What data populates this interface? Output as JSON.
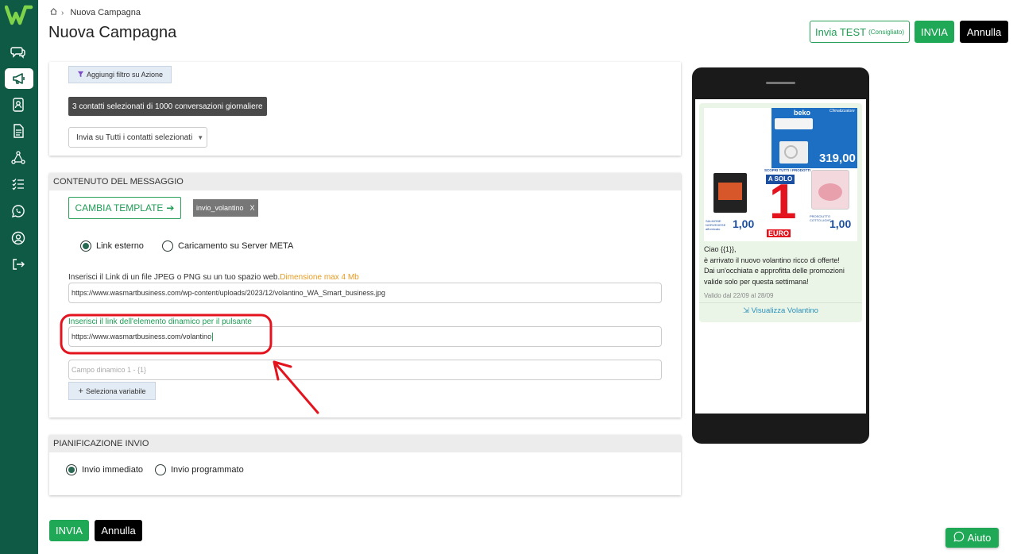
{
  "breadcrumb": {
    "current": "Nuova Campagna"
  },
  "header": {
    "title": "Nuova Campagna",
    "test_label": "Invia TEST",
    "test_hint": "(Consigliato)",
    "send_label": "INVIA",
    "cancel_label": "Annulla"
  },
  "filters": {
    "add_filter_label": "Aggiungi filtro su Azione",
    "selected_contacts": "3 contatti selezionati di 1000 conversazioni giornaliere",
    "send_scope": "Invia su Tutti i contatti selezionati"
  },
  "content": {
    "section_title": "CONTENUTO DEL MESSAGGIO",
    "change_template_label": "CAMBIA TEMPLATE",
    "template_chip": "invio_volantino",
    "template_chip_close": "X",
    "radio_external": "Link esterno",
    "radio_meta": "Caricamento su Server META",
    "link_label": "Inserisci il Link di un file JPEG o PNG su un tuo spazio web.",
    "link_size_hint": "Dimensione max 4 Mb",
    "link_value": "https://www.wasmartbusiness.com/wp-content/uploads/2023/12/volantino_WA_Smart_business.jpg",
    "dynamic_label": "Inserisci il link dell'elemento dinamico per il pulsante",
    "dynamic_value": "https://www.wasmartbusiness.com/volantino",
    "dynamic_field_placeholder": "Campo dinamico 1 - {1}",
    "select_variable_label": "Seleziona variabile"
  },
  "schedule": {
    "section_title": "PIANIFICAZIONE INVIO",
    "radio_immediate": "Invio immediato",
    "radio_scheduled": "Invio programmato"
  },
  "footer": {
    "send_label": "INVIA",
    "cancel_label": "Annulla"
  },
  "preview": {
    "flyer": {
      "brand": "beko",
      "header_text": "Climatizzatore",
      "price_main": "319,00",
      "price_left": "1,00",
      "price_right": "1,00",
      "promo_top": "SCOPRI TUTTI I PRODOTTI",
      "promo_a_solo": "A SOLO",
      "promo_one": "1",
      "promo_euro": "EURO",
      "left_caption": "SALMONE NORVEGESE affumicato",
      "right_caption": "PROSCIUTTO COTTO LIGHT"
    },
    "message_lines": [
      "Ciao {{1}},",
      "è arrivato il nuovo volantino ricco di offerte!",
      "Dai un'occhiata e approfitta delle promozioni",
      "valide solo per questa settimana!"
    ],
    "valid_text": "Valido dal 22/09 al 28/09",
    "link_label": "Visualizza Volantino"
  },
  "help": {
    "label": "Aiuto"
  },
  "colors": {
    "sidebar": "#0f5a44",
    "accent": "#1fa855",
    "annotation": "#e3141e"
  }
}
